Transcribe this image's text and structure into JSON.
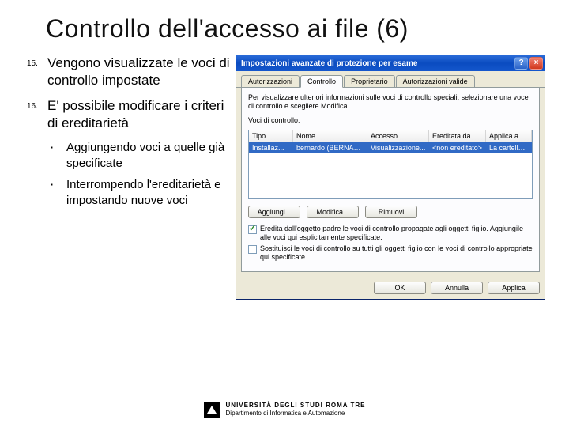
{
  "title": "Controllo dell'accesso ai file (6)",
  "list": {
    "n1": "15.",
    "t1": "Vengono visualizzate le voci di controllo impostate",
    "n2": "16.",
    "t2": "E' possibile modificare i criteri di ereditarietà",
    "s1": "Aggiungendo voci a quelle già specificate",
    "s2": "Interrompendo l'ereditarietà e impostando nuove voci"
  },
  "dialog": {
    "title": "Impostazioni avanzate di protezione per esame",
    "help": "?",
    "close": "×",
    "tabs": {
      "t1": "Autorizzazioni",
      "t2": "Controllo",
      "t3": "Proprietario",
      "t4": "Autorizzazioni valide"
    },
    "hint": "Per visualizzare ulteriori informazioni sulle voci di controllo speciali, selezionare una voce di controllo e scegliere Modifica.",
    "lvlabel": "Voci di controllo:",
    "cols": {
      "c1": "Tipo",
      "c2": "Nome",
      "c3": "Accesso",
      "c4": "Ereditata da",
      "c5": "Applica a"
    },
    "row": {
      "c1": "Installaz...",
      "c2": "bernardo (BERNARD...",
      "c3": "Visualizzazione...",
      "c4": "<non ereditato>",
      "c5": "La cartella selezio..."
    },
    "btns": {
      "add": "Aggiungi...",
      "edit": "Modifica...",
      "remove": "Rimuovi"
    },
    "chk1": "Eredita dall'oggetto padre le voci di controllo propagate agli oggetti figlio. Aggiungile alle voci qui esplicitamente specificate.",
    "chk2": "Sostituisci le voci di controllo su tutti gli oggetti figlio con le voci di controllo appropriate qui specificate.",
    "ok": "OK",
    "cancel": "Annulla",
    "apply": "Applica"
  },
  "footer": {
    "uni": "UNIVERSITÀ DEGLI STUDI ROMA TRE",
    "dept": "Dipartimento di Informatica e Automazione"
  }
}
